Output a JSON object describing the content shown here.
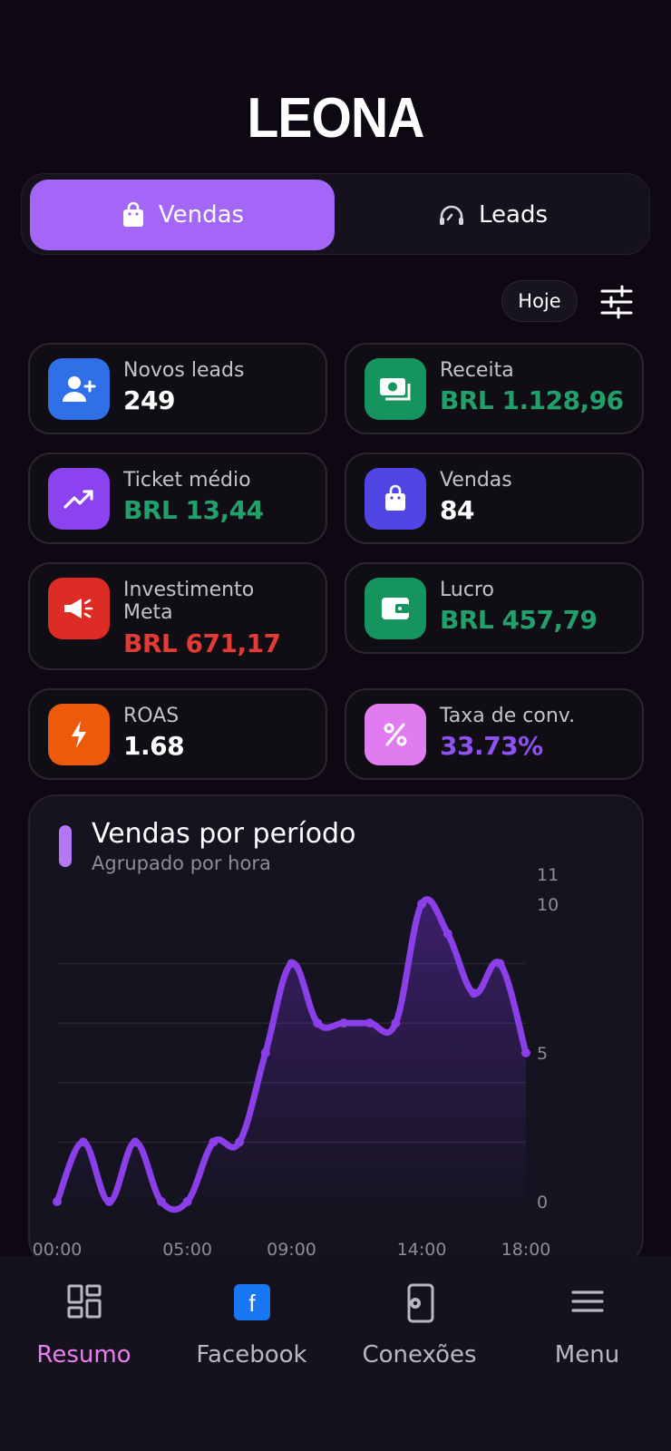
{
  "brand": {
    "logo_text": "LEONA"
  },
  "tabs": [
    {
      "label": "Vendas",
      "icon": "shopping-bag-icon",
      "active": true
    },
    {
      "label": "Leads",
      "icon": "headset-icon",
      "active": false
    }
  ],
  "period": {
    "label": "Hoje"
  },
  "metrics": [
    {
      "label": "Novos leads",
      "value": "249",
      "icon": "user-plus-icon",
      "icon_color": "#2f6fe8",
      "value_color": "#ffffff"
    },
    {
      "label": "Receita",
      "value": "BRL 1.128,96",
      "icon": "money-icon",
      "icon_color": "#16945f",
      "value_color": "#22a06b"
    },
    {
      "label": "Ticket médio",
      "value": "BRL 13,44",
      "icon": "trending-up-icon",
      "icon_color": "#8b43ef",
      "value_color": "#22a06b"
    },
    {
      "label": "Vendas",
      "value": "84",
      "icon": "shopping-bag-icon",
      "icon_color": "#5046e3",
      "value_color": "#ffffff"
    },
    {
      "label_line1": "Investimento",
      "label_line2": "Meta",
      "value": "BRL 671,17",
      "icon": "megaphone-icon",
      "icon_color": "#dd2b25",
      "value_color": "#e23a34"
    },
    {
      "label": "Lucro",
      "value": "BRL 457,79",
      "icon": "wallet-icon",
      "icon_color": "#16945f",
      "value_color": "#22a06b"
    },
    {
      "label": "ROAS",
      "value": "1.68",
      "icon": "bolt-icon",
      "icon_color": "#ee5a0c",
      "value_color": "#ffffff"
    },
    {
      "label": "Taxa de conv.",
      "value": "33.73%",
      "icon": "percent-icon",
      "icon_color": "#e07cf0",
      "value_color": "#8d52f0"
    }
  ],
  "chart": {
    "title": "Vendas por período",
    "subtitle": "Agrupado por hora"
  },
  "chart_data": {
    "type": "area",
    "title": "Vendas por período",
    "subtitle": "Agrupado por hora",
    "x": [
      "00:00",
      "01:00",
      "02:00",
      "03:00",
      "04:00",
      "05:00",
      "06:00",
      "07:00",
      "08:00",
      "09:00",
      "10:00",
      "11:00",
      "12:00",
      "13:00",
      "14:00",
      "15:00",
      "16:00",
      "17:00",
      "18:00"
    ],
    "x_tick_labels": [
      "00:00",
      "05:00",
      "09:00",
      "14:00",
      "18:00"
    ],
    "y_tick_labels": [
      "0",
      "5",
      "10",
      "11"
    ],
    "values": [
      0,
      2,
      0,
      2,
      0,
      0,
      2,
      2,
      5,
      8,
      6,
      6,
      6,
      6,
      10,
      9,
      7,
      8,
      5
    ],
    "ylim": [
      0,
      11
    ],
    "color": "#8a3fe8",
    "grid": true
  },
  "nav": [
    {
      "label": "Resumo",
      "icon": "dashboard-icon",
      "active": true
    },
    {
      "label": "Facebook",
      "icon": "facebook-icon",
      "active": false
    },
    {
      "label": "Conexões",
      "icon": "device-settings-icon",
      "active": false
    },
    {
      "label": "Menu",
      "icon": "hamburger-menu-icon",
      "active": false
    }
  ]
}
